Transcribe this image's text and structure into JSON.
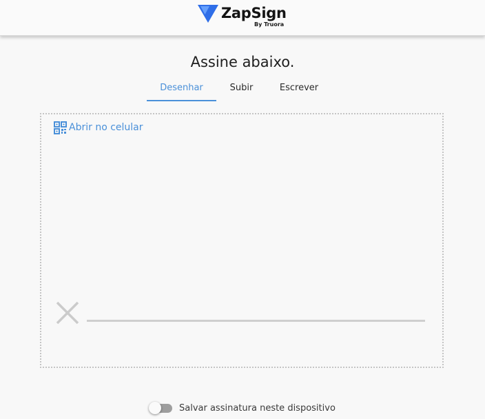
{
  "header": {
    "brand_name": "ZapSign",
    "brand_sub": "By Truora",
    "logo_icon": "zapsign-logo-icon",
    "brand_color": "#2f6ee8"
  },
  "title": "Assine abaixo.",
  "tabs": [
    {
      "label": "Desenhar",
      "active": true
    },
    {
      "label": "Subir",
      "active": false
    },
    {
      "label": "Escrever",
      "active": false
    }
  ],
  "accent_color": "#4a90d9",
  "signature_pad": {
    "open_on_phone_label": "Abrir no celular",
    "open_on_phone_icon": "qr-code-icon",
    "clear_icon": "x-icon"
  },
  "save_signature": {
    "label": "Salvar assinatura neste dispositivo",
    "enabled": false
  }
}
